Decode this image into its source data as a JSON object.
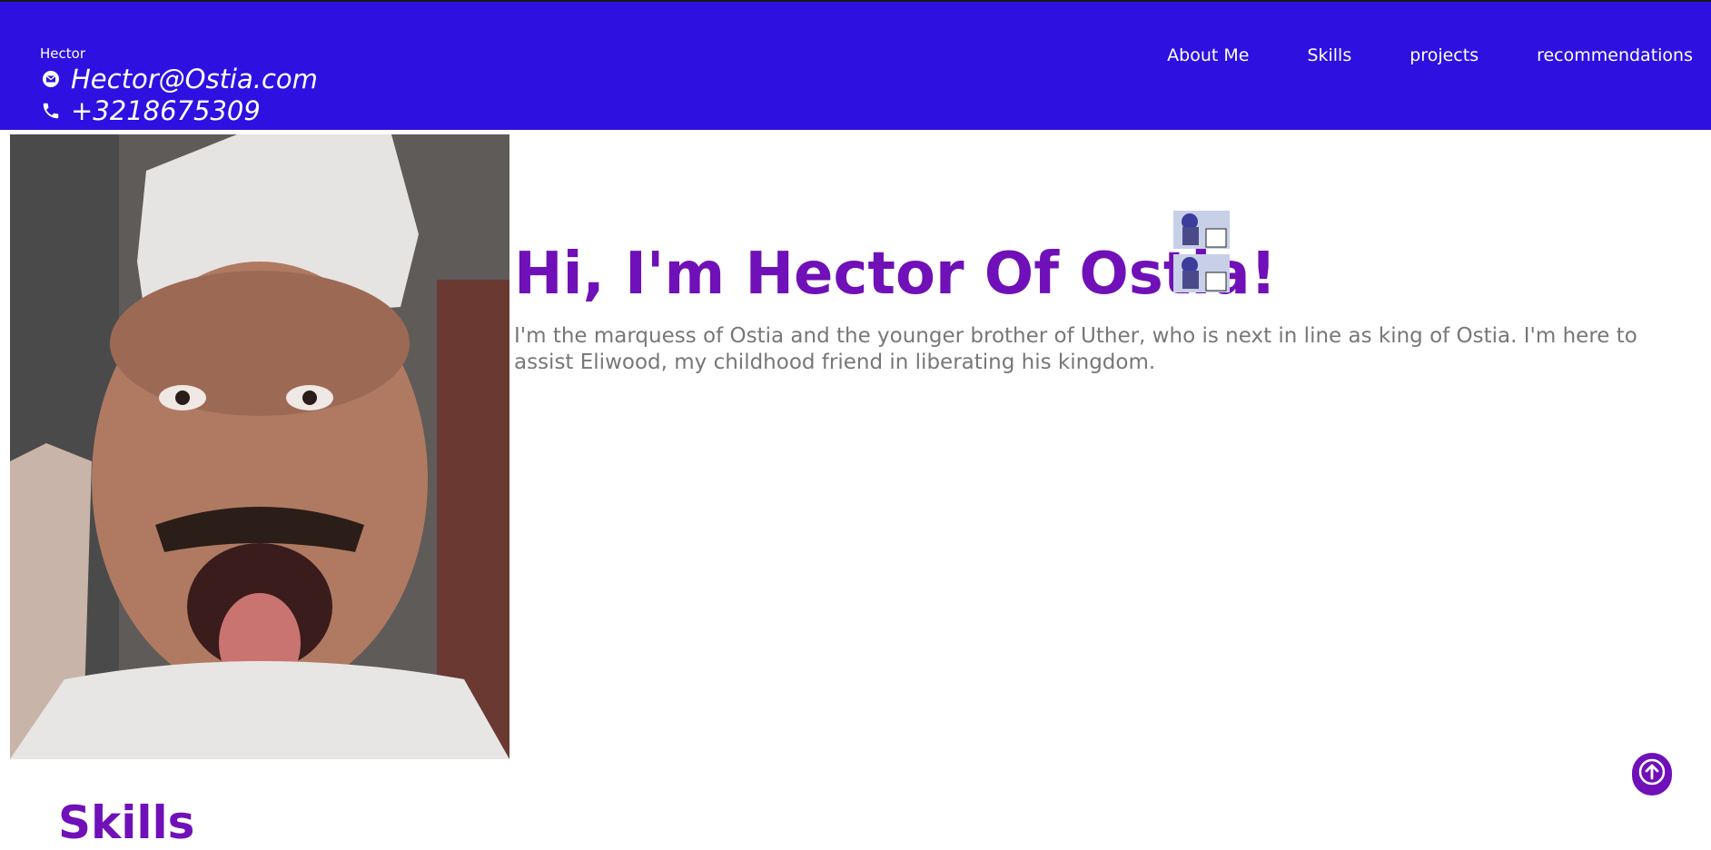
{
  "header": {
    "brand": "Hector",
    "email": "Hector@Ostia.com",
    "phone": "+3218675309",
    "nav": [
      "About Me",
      "Skills",
      "projects",
      "recommendations"
    ],
    "background_color": "#2e10e0"
  },
  "hero": {
    "title": "Hi, I'm Hector Of Ostia!",
    "description": "I'm the marquess of Ostia and the younger brother of Uther, who is next in line as king of Ostia. I'm here to assist Eliwood, my childhood friend in liberating his kingdom.",
    "accent_color": "#7010b8"
  },
  "skills": {
    "heading": "Skills"
  },
  "icons": {
    "email": "envelope-icon",
    "phone": "phone-icon",
    "scroll_top": "arrow-up-icon"
  }
}
